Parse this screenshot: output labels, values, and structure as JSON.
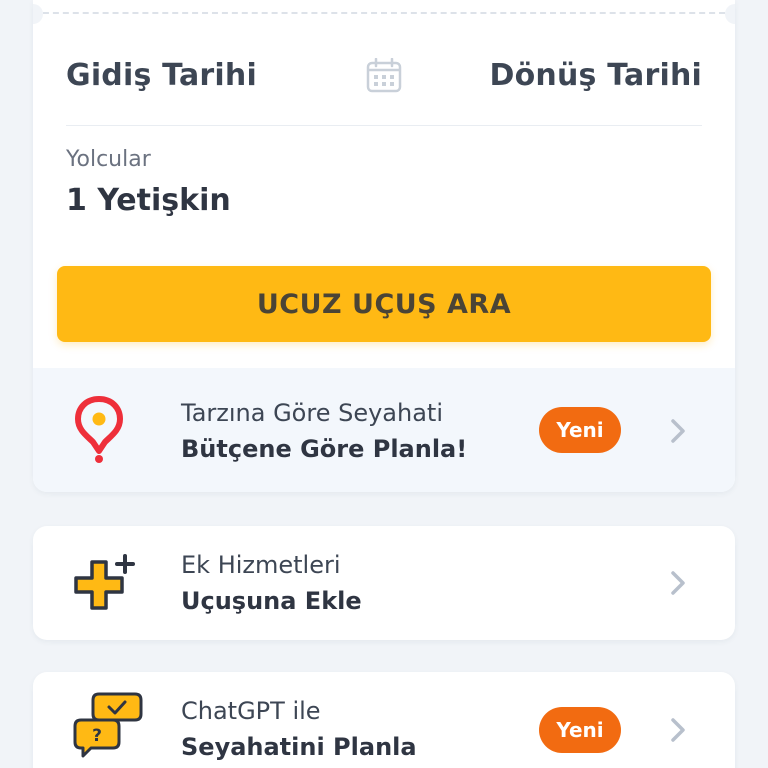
{
  "search": {
    "departure_label": "Gidiş Tarihi",
    "return_label": "Dönüş Tarihi",
    "passengers_label": "Yolcular",
    "passengers_value": "1 Yetişkin",
    "search_button_label": "UCUZ UÇUŞ ARA"
  },
  "features": [
    {
      "line1": "Tarzına Göre Seyahati",
      "line2": "Bütçene Göre Planla!",
      "badge": "Yeni",
      "icon": "location-question-icon"
    },
    {
      "line1": "Ek Hizmetleri",
      "line2": "Uçuşuna Ekle",
      "icon": "add-services-icon"
    },
    {
      "line1": "ChatGPT ile",
      "line2": "Seyahatini Planla",
      "badge": "Yeni",
      "icon": "chat-bubbles-icon"
    }
  ],
  "colors": {
    "primary_button": "#ffb914",
    "badge": "#f26b11",
    "text_dark": "#2f3542",
    "background": "#f1f4f8"
  }
}
